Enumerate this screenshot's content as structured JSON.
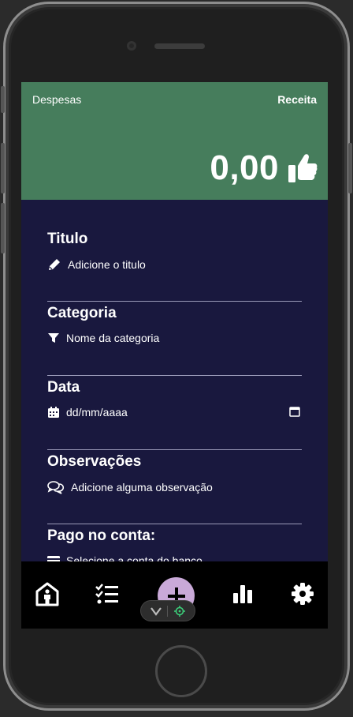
{
  "header": {
    "tab_despesas": "Despesas",
    "tab_receita": "Receita",
    "amount": "0,00",
    "bg_color": "#467d5c"
  },
  "form": {
    "titulo": {
      "label": "Titulo",
      "placeholder": "Adicione o titulo",
      "icon": "pencil-icon"
    },
    "categoria": {
      "label": "Categoria",
      "placeholder": "Nome da categoria",
      "icon": "filter-icon"
    },
    "data": {
      "label": "Data",
      "placeholder": "dd/mm/aaaa",
      "icon": "calendar-icon"
    },
    "observacoes": {
      "label": "Observações",
      "placeholder": "Adicione alguma observação",
      "icon": "comments-icon"
    },
    "conta": {
      "label": "Pago no conta:",
      "placeholder": "Selecione a conta do banco",
      "icon": "credit-card-icon"
    }
  },
  "nav": {
    "items": [
      "home-icon",
      "task-list-icon",
      "add-icon",
      "bar-chart-icon",
      "gear-icon"
    ],
    "fab_color": "#c9a9d8"
  },
  "colors": {
    "screen_bg": "#19183e",
    "nav_bg": "#000000"
  }
}
